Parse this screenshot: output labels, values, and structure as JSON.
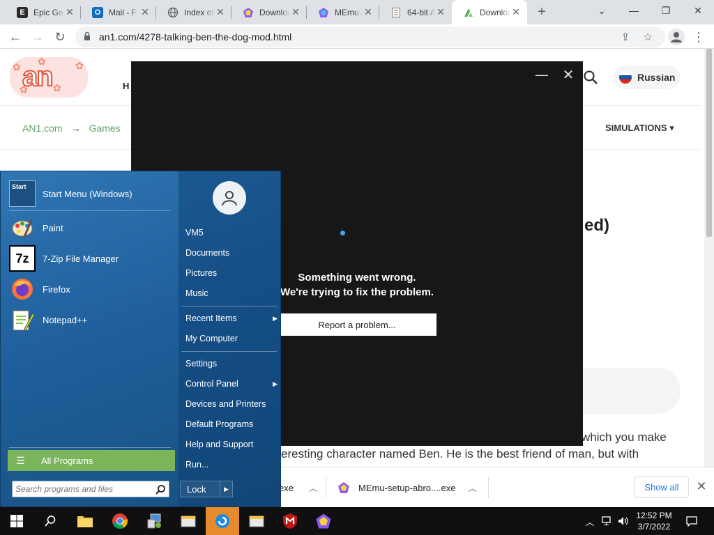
{
  "browser": {
    "tabs": [
      {
        "title": "Epic Games",
        "favicon": "epic-games-icon"
      },
      {
        "title": "Mail - F",
        "favicon": "outlook-icon"
      },
      {
        "title": "Index of",
        "favicon": "globe-icon"
      },
      {
        "title": "Download",
        "favicon": "memu-icon"
      },
      {
        "title": "MEmu A",
        "favicon": "memu-icon"
      },
      {
        "title": "64-bit A",
        "favicon": "document-icon"
      },
      {
        "title": "Download",
        "favicon": "an1-icon"
      }
    ],
    "url": "an1.com/4278-talking-ben-the-dog-mod.html"
  },
  "page": {
    "logo_text": "an",
    "header_fragment": "H",
    "language": "Russian",
    "breadcrumbs": [
      "AN1.com",
      "Games"
    ],
    "breadcrumb_arrow": "→",
    "category": "SIMULATIONS ▾",
    "heading_fragment": "ed)",
    "paragraph_line1": "which you make",
    "paragraph_line2": "eresting character named Ben. He is the best friend of man, but with"
  },
  "error_dialog": {
    "line1": "Something went wrong.",
    "line2": "We're trying to fix the problem.",
    "report_label": "Report a problem..."
  },
  "downloads": {
    "item1_name": "exe",
    "item2_name": "MEmu-setup-abro....exe",
    "show_all": "Show all"
  },
  "start_menu": {
    "pinned": [
      {
        "label": "Start Menu (Windows)",
        "icon": "start-menu-app-icon"
      },
      {
        "label": "Paint",
        "icon": "paint-icon"
      },
      {
        "label": "7-Zip File Manager",
        "icon": "7zip-icon"
      },
      {
        "label": "Firefox",
        "icon": "firefox-icon"
      },
      {
        "label": "Notepad++",
        "icon": "notepadpp-icon"
      }
    ],
    "all_programs": "All Programs",
    "search_placeholder": "Search programs and files",
    "right_items": [
      {
        "label": "VM5",
        "submenu": false
      },
      {
        "label": "Documents",
        "submenu": false
      },
      {
        "label": "Pictures",
        "submenu": false
      },
      {
        "label": "Music",
        "submenu": false
      },
      {
        "label": "Recent Items",
        "submenu": true
      },
      {
        "label": "My Computer",
        "submenu": false
      },
      {
        "label": "Settings",
        "submenu": false
      },
      {
        "label": "Control Panel",
        "submenu": true
      },
      {
        "label": "Devices and Printers",
        "submenu": false
      },
      {
        "label": "Default Programs",
        "submenu": false
      },
      {
        "label": "Help and Support",
        "submenu": false
      },
      {
        "label": "Run...",
        "submenu": false
      }
    ],
    "lock_label": "Lock"
  },
  "taskbar": {
    "time": "12:52 PM",
    "date": "3/7/2022",
    "apps": [
      "start-button",
      "search-icon",
      "file-explorer-icon",
      "chrome-icon",
      "control-panel-icon",
      "explorer-window-icon",
      "memu-app-icon",
      "explorer-window-icon",
      "mcafee-icon",
      "memu-icon"
    ]
  },
  "colors": {
    "start_menu_blue": "#1f5f9c",
    "all_programs_green": "#7ab55c",
    "taskbar_active": "#e58a2d",
    "breadcrumb_green": "#5fa36a"
  }
}
